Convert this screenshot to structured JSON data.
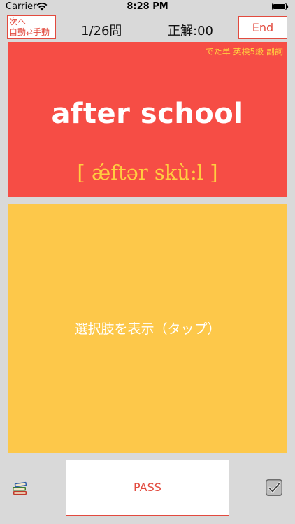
{
  "status_bar": {
    "carrier": "Carrier",
    "time": "8:28 PM",
    "icons": [
      "wifi-icon",
      "battery-icon"
    ]
  },
  "top_bar": {
    "mode_line1": "次へ",
    "mode_line2": "自動⇄手動",
    "progress": "1/26問",
    "score": "正解:00",
    "end_label": "End"
  },
  "word_card": {
    "category": "でた単 英検5級  副詞",
    "word": "after school",
    "pronunciation": "[ ǽftər skù:l ]"
  },
  "choices_card": {
    "label": "選択肢を表示（タップ）"
  },
  "bottom_bar": {
    "pass_label": "PASS",
    "icons": [
      "book-icon",
      "checkbox-icon"
    ]
  },
  "colors": {
    "background": "#d9d9d9",
    "word_card": "#f64d45",
    "choices_card": "#fdc84a",
    "accent_red": "#e24a3e",
    "accent_yellow": "#ffcf40"
  }
}
